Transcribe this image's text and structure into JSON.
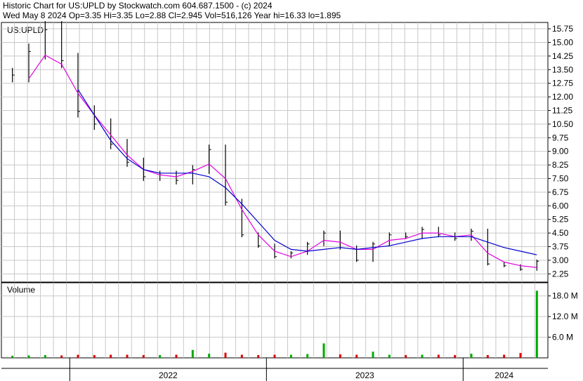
{
  "header": {
    "line1": "Historic Chart for US:UPLD by Stockwatch.com 604.687.1500 - (c) 2024",
    "line2": "Wed May  8 2024  Op=3.35  Hi=3.35  Lo=2.88  Cl=2.945  Vol=516,126  Year hi=16.33  lo=1.895"
  },
  "colors": {
    "grid": "#c8c8c8",
    "price_bars": "#000000",
    "ma_short": "#e000e0",
    "ma_long": "#0000cc",
    "volume_up": "#00aa00",
    "volume_down": "#dd0000"
  },
  "chart_data": [
    {
      "type": "line",
      "symbol": "US:UPLD",
      "ylim": [
        1.8,
        16.1
      ],
      "yticks": [
        "15.75",
        "15.00",
        "14.25",
        "13.50",
        "12.75",
        "12.00",
        "11.25",
        "10.50",
        "9.75",
        "9.00",
        "8.25",
        "7.50",
        "6.75",
        "6.00",
        "5.25",
        "4.50",
        "3.75",
        "3.00",
        "2.25"
      ],
      "x": [
        "2021-09",
        "2021-10",
        "2021-11",
        "2021-12",
        "2022-01",
        "2022-02",
        "2022-03",
        "2022-04",
        "2022-05",
        "2022-06",
        "2022-07",
        "2022-08",
        "2022-09",
        "2022-10",
        "2022-11",
        "2022-12",
        "2023-01",
        "2023-02",
        "2023-03",
        "2023-04",
        "2023-05",
        "2023-06",
        "2023-07",
        "2023-08",
        "2023-09",
        "2023-10",
        "2023-11",
        "2023-12",
        "2024-01",
        "2024-02",
        "2024-03",
        "2024-04",
        "2024-05"
      ],
      "series": [
        {
          "values": [
            13.2,
            14.5,
            15.7,
            14.0,
            11.2,
            10.5,
            9.4,
            8.4,
            7.6,
            7.7,
            7.4,
            8.0,
            9.1,
            6.2,
            4.4,
            3.8,
            3.2,
            3.4,
            3.9,
            4.5,
            3.7,
            3.0,
            3.9,
            4.4,
            4.3,
            4.7,
            4.4,
            4.2,
            4.6,
            2.8,
            2.7,
            2.5,
            2.95
          ]
        },
        {
          "values": [
            null,
            13.0,
            14.3,
            13.8,
            12.2,
            11.0,
            9.9,
            8.8,
            8.0,
            7.7,
            7.6,
            7.9,
            8.3,
            7.5,
            5.8,
            4.4,
            3.5,
            3.2,
            3.5,
            4.1,
            4.0,
            3.6,
            3.6,
            4.1,
            4.2,
            4.5,
            4.5,
            4.3,
            4.4,
            3.4,
            2.9,
            2.7,
            2.6
          ]
        },
        {
          "values": [
            null,
            null,
            null,
            null,
            12.4,
            11.0,
            9.6,
            8.6,
            8.0,
            7.8,
            7.8,
            7.8,
            7.6,
            7.0,
            6.1,
            5.1,
            4.1,
            3.6,
            3.5,
            3.6,
            3.7,
            3.6,
            3.7,
            3.8,
            4.0,
            4.2,
            4.3,
            4.3,
            4.3,
            4.0,
            3.7,
            3.5,
            3.3
          ]
        }
      ]
    },
    {
      "type": "bar",
      "title": "Volume",
      "yticks": [
        "18.0 M",
        "12.0 M",
        "6.0 M"
      ],
      "ylim": [
        0,
        21
      ],
      "categories": [
        "2021-09",
        "2021-10",
        "2021-11",
        "2021-12",
        "2022-01",
        "2022-02",
        "2022-03",
        "2022-04",
        "2022-05",
        "2022-06",
        "2022-07",
        "2022-08",
        "2022-09",
        "2022-10",
        "2022-11",
        "2022-12",
        "2023-01",
        "2023-02",
        "2023-03",
        "2023-04",
        "2023-05",
        "2023-06",
        "2023-07",
        "2023-08",
        "2023-09",
        "2023-10",
        "2023-11",
        "2023-12",
        "2024-01",
        "2024-02",
        "2024-03",
        "2024-04",
        "2024-05"
      ],
      "values": [
        0.6,
        0.7,
        0.8,
        0.7,
        0.9,
        0.8,
        0.9,
        0.9,
        0.8,
        0.8,
        0.9,
        2.3,
        1.2,
        1.5,
        0.9,
        0.8,
        0.9,
        0.9,
        1.1,
        4.2,
        1.0,
        0.9,
        1.8,
        0.9,
        0.8,
        0.9,
        0.9,
        0.8,
        1.2,
        0.8,
        0.9,
        1.4,
        19.5
      ]
    }
  ],
  "xaxis": {
    "labels": [
      "2022",
      "2023",
      "2024"
    ]
  }
}
